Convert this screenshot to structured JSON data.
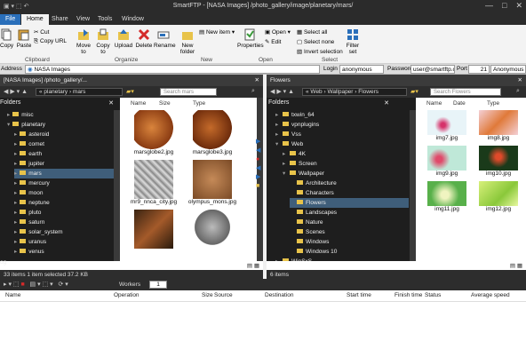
{
  "title": "SmartFTP - [NASA Images] /photo_gallery/image/planetary/mars/",
  "tabs": {
    "file": "File",
    "home": "Home",
    "share": "Share",
    "view": "View",
    "tools": "Tools",
    "window": "Window"
  },
  "ribbon": {
    "copy": "Copy",
    "paste": "Paste",
    "cut": "Cut",
    "copy_url": "Copy URL",
    "move_to": "Move to",
    "copy_to": "Copy to",
    "upload": "Upload",
    "delete": "Delete",
    "rename": "Rename",
    "new_folder": "New folder",
    "new_item": "New item",
    "properties": "Properties",
    "open": "Open",
    "edit": "Edit",
    "select_all": "Select all",
    "select_none": "Select none",
    "invert_selection": "Invert selection",
    "filter_set": "Filter set",
    "groups": {
      "clipboard": "Clipboard",
      "organize": "Organize",
      "new": "New",
      "open": "Open",
      "select": "Select"
    }
  },
  "addressbar": {
    "label": "Address",
    "value": "NASA Images",
    "login_label": "Login",
    "login": "anonymous",
    "password_label": "Password",
    "password": "user@smartftp.com",
    "port_label": "Port",
    "port": "21",
    "mode": "Anonymous"
  },
  "left_pane": {
    "header": "[NASA Images] /photo_gallery/...",
    "breadcrumb": "« planetary › mars",
    "search_placeholder": "Search mars",
    "folders_title": "Folders",
    "folders": [
      "misc",
      "planetary",
      "asteroid",
      "comet",
      "earth",
      "jupiter",
      "mars",
      "mercury",
      "moon",
      "neptune",
      "pluto",
      "saturn",
      "solar_system",
      "uranus",
      "venus"
    ],
    "columns": [
      "Name",
      "Size",
      "Type"
    ],
    "files": [
      {
        "name": "marsglobe2.jpg"
      },
      {
        "name": "marsglobe3.jpg"
      },
      {
        "name": "mr9_nnca_city.jpg"
      },
      {
        "name": "olympus_mons.jpg"
      },
      {
        "name": ""
      },
      {
        "name": ""
      }
    ],
    "status": "33 items   1 item selected 37.2 KB",
    "log": "og"
  },
  "right_pane": {
    "header": "Flowers",
    "breadcrumb": "« Web › Wallpaper › Flowers",
    "search_placeholder": "Search Flowers",
    "folders_title": "Folders",
    "folders": [
      "txwin_64",
      "vpnplugins",
      "Vss",
      "Web",
      "4K",
      "Screen",
      "Wallpaper",
      "Architecture",
      "Characters",
      "Flowers",
      "Landscapes",
      "Nature",
      "Scenes",
      "Windows",
      "Windows 10",
      "WinSxS"
    ],
    "columns": [
      "Name",
      "Date",
      "Type"
    ],
    "files": [
      {
        "name": "img7.jpg"
      },
      {
        "name": "img8.jpg"
      },
      {
        "name": "img9.jpg"
      },
      {
        "name": "img10.jpg"
      },
      {
        "name": "img11.jpg"
      },
      {
        "name": "img12.jpg"
      }
    ],
    "status": "6 items"
  },
  "transfer": {
    "workers_label": "Workers",
    "workers": "1",
    "columns": [
      "Name",
      "Operation",
      "Size",
      "Source",
      "Destination",
      "Start time",
      "Finish time",
      "Status",
      "Average speed"
    ]
  }
}
